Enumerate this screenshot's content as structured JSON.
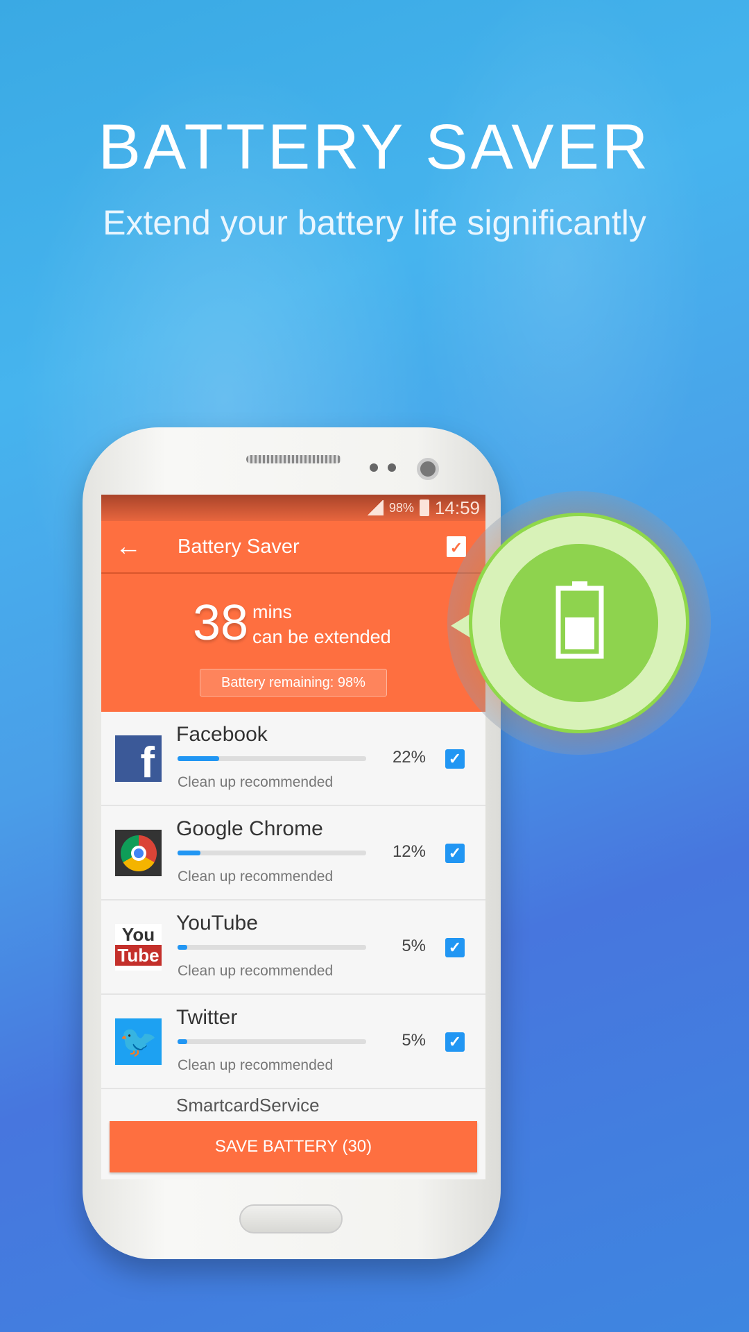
{
  "promo": {
    "title": "BATTERY SAVER",
    "subtitle": "Extend your battery life significantly"
  },
  "status_bar": {
    "battery": "98%",
    "time": "14:59"
  },
  "toolbar": {
    "title": "Battery Saver",
    "back_icon": "arrow-left-icon",
    "action_icon": "checklist-icon"
  },
  "hero": {
    "minutes": "38",
    "unit": "mins",
    "caption": "can be extended",
    "remaining": "Battery remaining: 98%"
  },
  "apps": [
    {
      "name": "Facebook",
      "percent": "22%",
      "usage": 22,
      "note": "Clean up recommended",
      "checked": true
    },
    {
      "name": "Google Chrome",
      "percent": "12%",
      "usage": 12,
      "note": "Clean up recommended",
      "checked": true
    },
    {
      "name": "YouTube",
      "percent": "5%",
      "usage": 5,
      "note": "Clean up recommended",
      "checked": true
    },
    {
      "name": "Twitter",
      "percent": "5%",
      "usage": 5,
      "note": "Clean up recommended",
      "checked": true
    }
  ],
  "partial_app": "SmartcardService",
  "save_button": "SAVE BATTERY (30)",
  "colors": {
    "accent": "#fe6f40",
    "progress": "#2196f3",
    "badge": "#8ed34e"
  }
}
